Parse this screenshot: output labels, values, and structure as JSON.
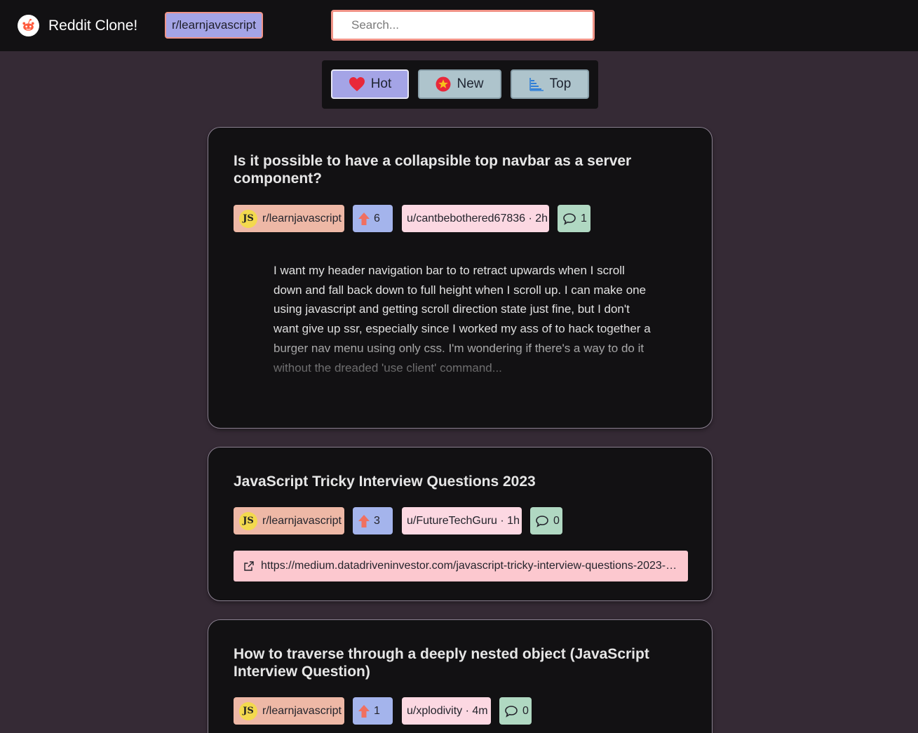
{
  "header": {
    "brand": "Reddit Clone!",
    "current_subreddit": "r/learnjavascript",
    "search_placeholder": "Search..."
  },
  "sort": {
    "hot_label": "Hot",
    "new_label": "New",
    "top_label": "Top",
    "active": "Hot"
  },
  "posts": [
    {
      "title": "Is it possible to have a collapsible top navbar as a server component?",
      "subreddit": "r/learnjavascript",
      "votes": "6",
      "author_time": "u/cantbebothered67836 · 2h",
      "comments": "1",
      "body": "I want my header navigation bar to to retract upwards when I scroll down and fall back down to full height when I scroll up. I can make one using javascript and getting scroll direction state just fine, but I don't want give up ssr, especially since I worked my ass of to hack together a burger nav menu using only css. I'm wondering if there's a way to do it without the dreaded 'use client' command..."
    },
    {
      "title": "JavaScript Tricky Interview Questions 2023",
      "subreddit": "r/learnjavascript",
      "votes": "3",
      "author_time": "u/FutureTechGuru · 1h",
      "comments": "0",
      "link": "https://medium.datadriveninvestor.com/javascript-tricky-interview-questions-2023-3..."
    },
    {
      "title": "How to traverse through a deeply nested object (JavaScript Interview Question)",
      "subreddit": "r/learnjavascript",
      "votes": "1",
      "author_time": "u/xplodivity · 4m",
      "comments": "0"
    }
  ],
  "colors": {
    "background": "#352a35",
    "topbar": "#121113",
    "accent_border": "#f19488",
    "active_sort": "#a4a4e6",
    "inactive_sort": "#aec4cc",
    "chip_subreddit": "#eeb8a6",
    "chip_votes": "#a4b4ec",
    "chip_user": "#fcd8e2",
    "chip_comments": "#b0d8c2",
    "link_bar": "#fcc8cf"
  },
  "icons": {
    "logo": "reddit-alien-icon",
    "hot": "heart-icon",
    "new": "star-badge-icon",
    "top": "bar-chart-icon",
    "votes": "upvote-arrow-icon",
    "comments": "speech-bubble-icon",
    "link": "external-link-icon",
    "subreddit": "javascript-badge-icon"
  }
}
